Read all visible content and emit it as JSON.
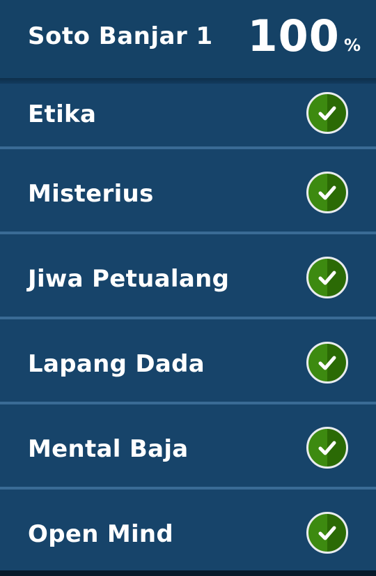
{
  "header": {
    "title": "Soto Banjar 1",
    "progress_value": "100",
    "progress_unit": "%"
  },
  "colors": {
    "background": "#17446a",
    "divider": "#3a6b95",
    "check_green": "#3d8a10",
    "text": "#ffffff"
  },
  "items": [
    {
      "label": "Etika",
      "status": "completed",
      "icon": "check-circle-icon"
    },
    {
      "label": "Misterius",
      "status": "completed",
      "icon": "check-circle-icon"
    },
    {
      "label": "Jiwa Petualang",
      "status": "completed",
      "icon": "check-circle-icon"
    },
    {
      "label": "Lapang Dada",
      "status": "completed",
      "icon": "check-circle-icon"
    },
    {
      "label": "Mental Baja",
      "status": "completed",
      "icon": "check-circle-icon"
    },
    {
      "label": "Open Mind",
      "status": "completed",
      "icon": "check-circle-icon"
    }
  ]
}
